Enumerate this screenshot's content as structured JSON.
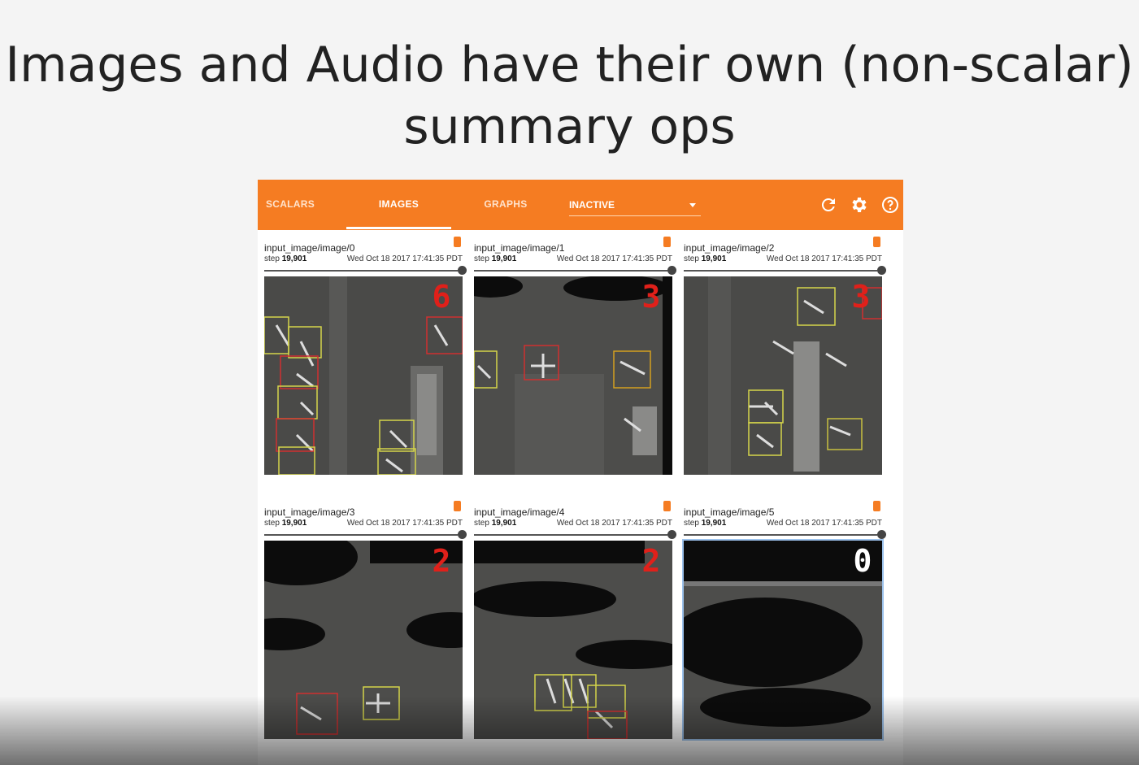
{
  "slide": {
    "title_line1": "Images and Audio have their own (non-scalar)",
    "title_line2": "summary ops"
  },
  "toolbar": {
    "tabs": [
      {
        "label": "SCALARS",
        "active": false
      },
      {
        "label": "IMAGES",
        "active": true
      },
      {
        "label": "GRAPHS",
        "active": false
      }
    ],
    "inactive_dropdown": "INACTIVE",
    "icons": [
      "refresh-icon",
      "settings-gear-icon",
      "help-icon"
    ],
    "accent_color": "#f57c22"
  },
  "cards": [
    {
      "tag": "input_image/image/0",
      "step_label": "step",
      "step": "19,901",
      "time": "Wed Oct 18 2017 17:41:35 PDT",
      "digit": "6",
      "digit_color": "#e0201a"
    },
    {
      "tag": "input_image/image/1",
      "step_label": "step",
      "step": "19,901",
      "time": "Wed Oct 18 2017 17:41:35 PDT",
      "digit": "3",
      "digit_color": "#e0201a"
    },
    {
      "tag": "input_image/image/2",
      "step_label": "step",
      "step": "19,901",
      "time": "Wed Oct 18 2017 17:41:35 PDT",
      "digit": "3",
      "digit_color": "#e0201a"
    },
    {
      "tag": "input_image/image/3",
      "step_label": "step",
      "step": "19,901",
      "time": "Wed Oct 18 2017 17:41:35 PDT",
      "digit": "2",
      "digit_color": "#e0201a"
    },
    {
      "tag": "input_image/image/4",
      "step_label": "step",
      "step": "19,901",
      "time": "Wed Oct 18 2017 17:41:35 PDT",
      "digit": "2",
      "digit_color": "#e0201a"
    },
    {
      "tag": "input_image/image/5",
      "step_label": "step",
      "step": "19,901",
      "time": "Wed Oct 18 2017 17:41:35 PDT",
      "digit": "0",
      "digit_color": "#ffffff"
    }
  ]
}
